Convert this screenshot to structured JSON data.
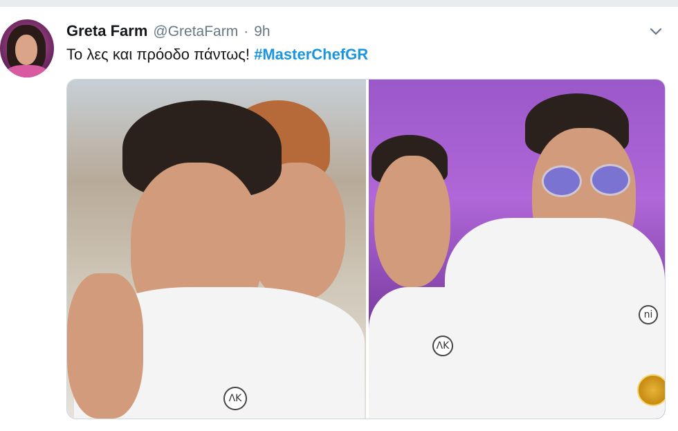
{
  "tweet": {
    "author_name": "Greta Farm",
    "author_handle": "@GretaFarm",
    "separator": "·",
    "timestamp": "9h",
    "text": "Το λες και πρόοδο πάντως!",
    "hashtag": "#MasterChefGR",
    "menu_icon": "chevron-down-icon",
    "avatar_icon": "user-avatar"
  },
  "media": {
    "left_logo": "ΛΚ",
    "right_logo": "ΛΚ",
    "right_logo2": "ni"
  },
  "colors": {
    "hashtag": "#1b95e0",
    "name": "#14171a",
    "muted": "#657786"
  }
}
